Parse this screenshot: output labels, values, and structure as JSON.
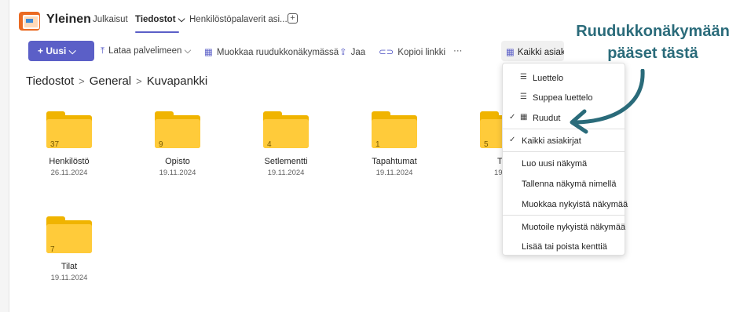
{
  "header": {
    "team_name": "Yleinen",
    "tabs": [
      {
        "label": "Julkaisut"
      },
      {
        "label": "Tiedostot ⌵"
      },
      {
        "label": "Henkilöstöpalaverit asi..."
      }
    ],
    "add_tab": "+"
  },
  "toolbar": {
    "new_label": "+ Uusi ⌵",
    "upload_label": "Lataa palvelimeen ⌵",
    "grid_edit_label": "Muokkaa ruudukkonäkymässä",
    "share_label": "Jaa",
    "copy_link_label": "Kopioi linkki",
    "more_label": "···",
    "view_label": "Kaikki asiakirjat"
  },
  "breadcrumb": {
    "items": [
      "Tiedostot",
      "General",
      "Kuvapankki"
    ],
    "separator": ">"
  },
  "folders": [
    {
      "count": "37",
      "name": "Henkilöstö",
      "date": "26.11.2024"
    },
    {
      "count": "9",
      "name": "Opisto",
      "date": "19.11.2024"
    },
    {
      "count": "4",
      "name": "Setlementti",
      "date": "19.11.2024"
    },
    {
      "count": "1",
      "name": "Tapahtumat",
      "date": "19.11.2024"
    },
    {
      "count": "5",
      "name": "T",
      "date": "19"
    },
    {
      "count": "7",
      "name": "Tilat",
      "date": "19.11.2024"
    }
  ],
  "view_menu": {
    "items": [
      {
        "label": "Luettelo",
        "icon": "list-icon",
        "checked": false
      },
      {
        "label": "Suppea luettelo",
        "icon": "compact-list-icon",
        "checked": false
      },
      {
        "label": "Ruudut",
        "icon": "tiles-icon",
        "checked": true
      },
      {
        "label": "Kaikki asiakirjat",
        "checked": true
      },
      {
        "label": "Luo uusi näkymä"
      },
      {
        "label": "Tallenna näkymä nimellä"
      },
      {
        "label": "Muokkaa nykyistä näkymää"
      },
      {
        "label": "Muotoile nykyistä näkymää"
      },
      {
        "label": "Lisää tai poista kenttiä"
      }
    ],
    "check_mark": "✓"
  },
  "annotation": {
    "line1": "Ruudukkonäkymään",
    "line2": "pääset tästä",
    "color": "#2a6b7a"
  },
  "colors": {
    "accent": "#5b5fc7",
    "folder": "#ffcb3a"
  }
}
